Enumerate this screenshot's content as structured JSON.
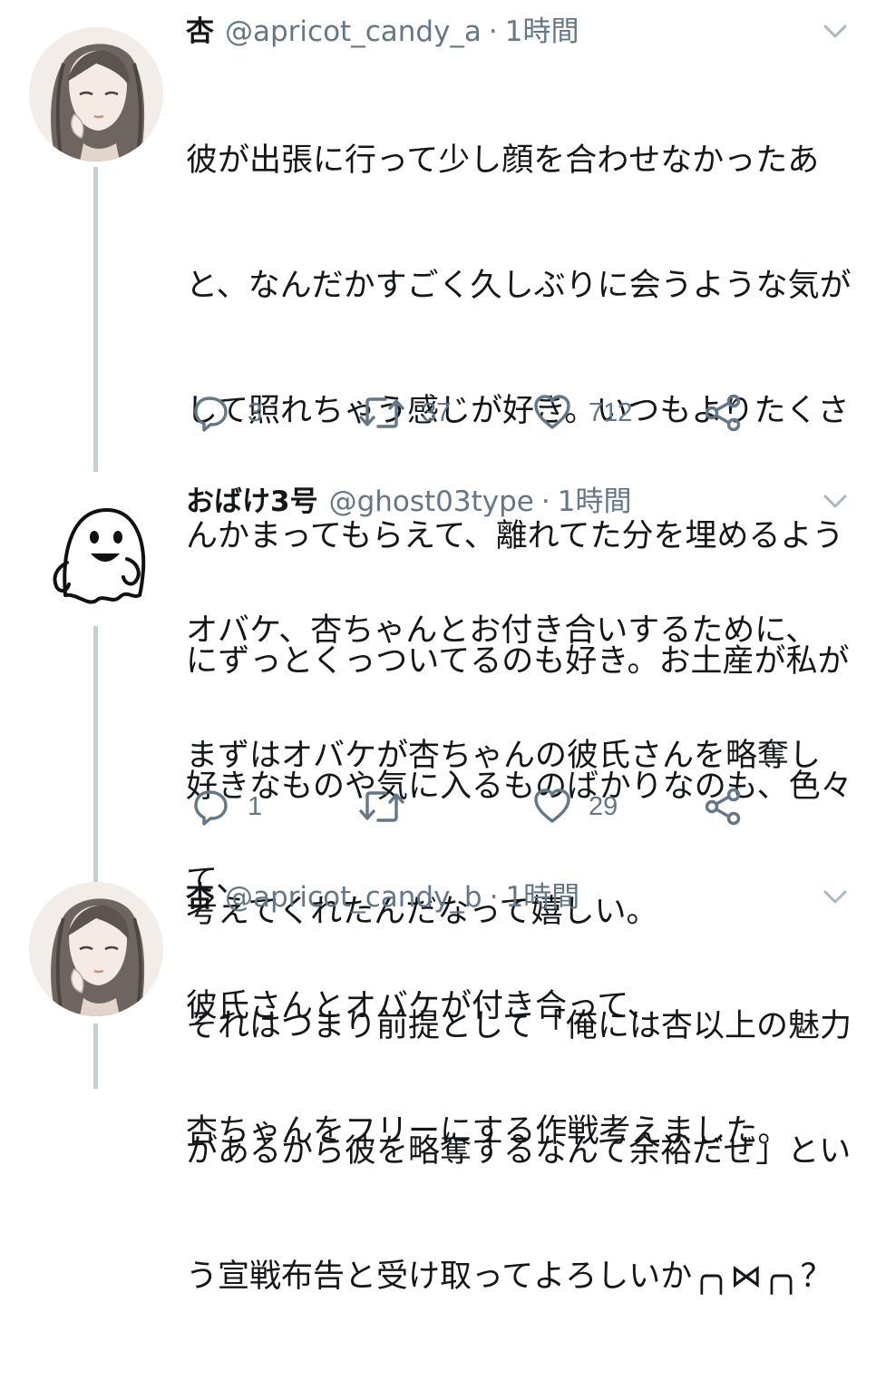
{
  "tweets": [
    {
      "name": "杏",
      "handle": "@apricot_candy_a",
      "separator": "·",
      "time": "1時間",
      "avatar": "anime-girl-avatar",
      "lines": [
        "彼が出張に行って少し顔を合わせなかったあ",
        "と、なんだかすごく久しぶりに会うような気が",
        "して照れちゃう感じが好き。いつもよりたくさ",
        "んかまってもらえて、離れてた分を埋めるよう",
        "にずっとくっついてるのも好き。お土産が私が",
        "好きなものや気に入るものばかりなのも、色々",
        "考えてくれたんだなって嬉しい。"
      ],
      "reply_count": "3",
      "retweet_count": "37",
      "like_count": "712"
    },
    {
      "name": "おばけ3号",
      "handle": "@ghost03type",
      "separator": "·",
      "time": "1時間",
      "avatar": "ghost-avatar",
      "lines": [
        "オバケ、杏ちゃんとお付き合いするために、",
        "まずはオバケが杏ちゃんの彼氏さんを略奪し",
        "て、",
        "彼氏さんとオバケが付き合って、",
        "杏ちゃんをフリーにする作戦考えました。"
      ],
      "reply_count": "1",
      "retweet_count": "",
      "like_count": "29"
    },
    {
      "name": "杏",
      "handle": "@apricot_candy_b",
      "separator": "·",
      "time": "1時間",
      "avatar": "anime-girl-avatar",
      "lines": [
        "それはつまり前提として「俺には杏以上の魅力",
        "があるから彼を略奪するなんて余裕だぜ」とい",
        "う宣戦布告と受け取ってよろしいか╭╮⋈╭╮？"
      ]
    }
  ],
  "icons": [
    "reply-icon",
    "retweet-icon",
    "like-icon",
    "share-icon",
    "chevron-down-icon"
  ],
  "colors": {
    "text": "#14171a",
    "secondary": "#657786",
    "thread_line": "#c4cfd6"
  }
}
